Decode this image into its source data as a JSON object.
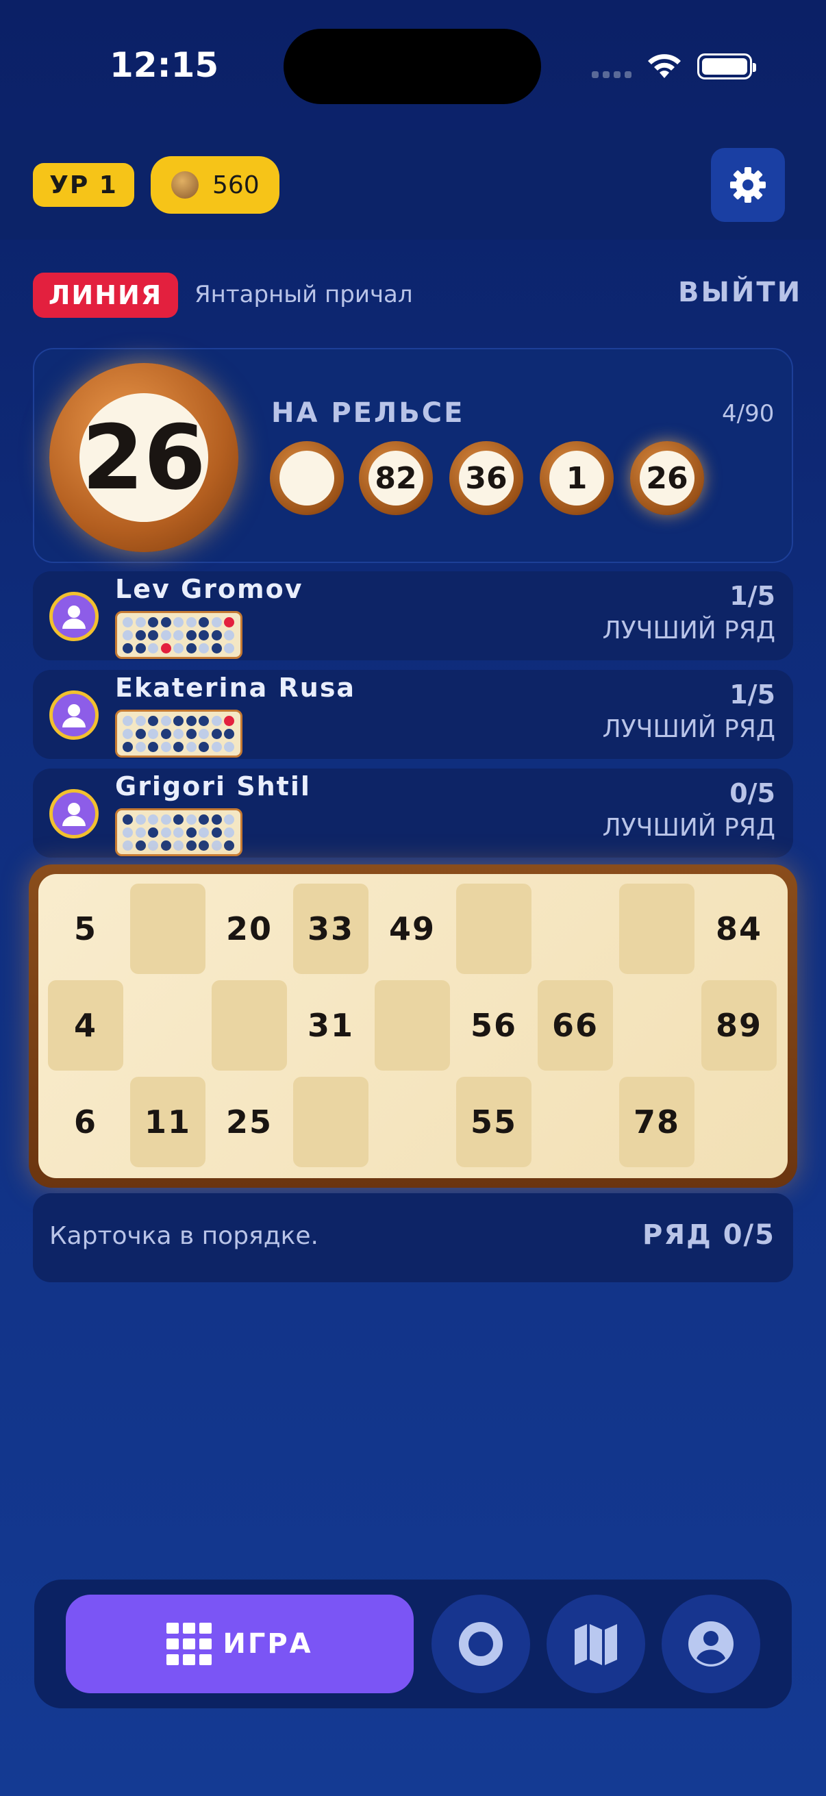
{
  "status_bar": {
    "time": "12:15"
  },
  "header": {
    "level": "УР 1",
    "coins": "560"
  },
  "game": {
    "mode": "ЛИНИЯ",
    "location": "Янтарный причал",
    "exit_label": "ВЫЙТИ"
  },
  "draw": {
    "current": "26",
    "rail_label": "НА РЕЛЬСЕ",
    "count": "4/90",
    "rail": [
      "",
      "82",
      "36",
      "1",
      "26"
    ]
  },
  "players": [
    {
      "name": "Lev Gromov",
      "score": "1/5",
      "best_label": "ЛУЧШИЙ РЯД"
    },
    {
      "name": "Ekaterina Rusa",
      "score": "1/5",
      "best_label": "ЛУЧШИЙ РЯД"
    },
    {
      "name": "Grigori Shtil",
      "score": "0/5",
      "best_label": "ЛУЧШИЙ РЯД"
    }
  ],
  "card": {
    "rows": [
      [
        "5",
        "",
        "20",
        "33",
        "49",
        "",
        "",
        "",
        "84"
      ],
      [
        "4",
        "",
        "",
        "31",
        "",
        "56",
        "66",
        "",
        "89"
      ],
      [
        "6",
        "11",
        "25",
        "",
        "",
        "55",
        "",
        "78",
        ""
      ]
    ]
  },
  "card_status": {
    "text": "Карточка в порядке.",
    "row_progress": "РЯД 0/5"
  },
  "nav": {
    "game_label": "ИГРА"
  },
  "colors": {
    "accent": "#7b55f5",
    "mode_badge": "#e3203e",
    "coin_badge": "#f6c418"
  }
}
